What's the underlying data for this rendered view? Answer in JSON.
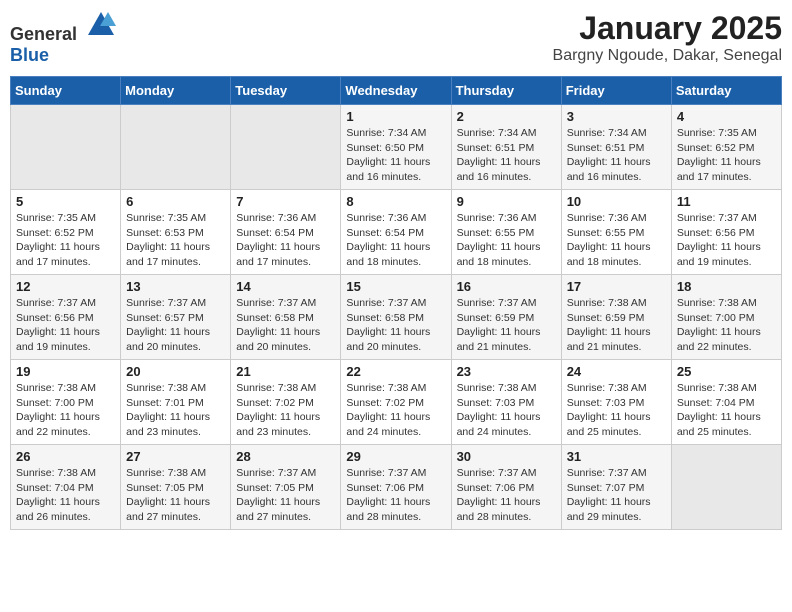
{
  "header": {
    "logo_general": "General",
    "logo_blue": "Blue",
    "month": "January 2025",
    "location": "Bargny Ngoude, Dakar, Senegal"
  },
  "weekdays": [
    "Sunday",
    "Monday",
    "Tuesday",
    "Wednesday",
    "Thursday",
    "Friday",
    "Saturday"
  ],
  "weeks": [
    [
      {
        "day": "",
        "info": ""
      },
      {
        "day": "",
        "info": ""
      },
      {
        "day": "",
        "info": ""
      },
      {
        "day": "1",
        "info": "Sunrise: 7:34 AM\nSunset: 6:50 PM\nDaylight: 11 hours\nand 16 minutes."
      },
      {
        "day": "2",
        "info": "Sunrise: 7:34 AM\nSunset: 6:51 PM\nDaylight: 11 hours\nand 16 minutes."
      },
      {
        "day": "3",
        "info": "Sunrise: 7:34 AM\nSunset: 6:51 PM\nDaylight: 11 hours\nand 16 minutes."
      },
      {
        "day": "4",
        "info": "Sunrise: 7:35 AM\nSunset: 6:52 PM\nDaylight: 11 hours\nand 17 minutes."
      }
    ],
    [
      {
        "day": "5",
        "info": "Sunrise: 7:35 AM\nSunset: 6:52 PM\nDaylight: 11 hours\nand 17 minutes."
      },
      {
        "day": "6",
        "info": "Sunrise: 7:35 AM\nSunset: 6:53 PM\nDaylight: 11 hours\nand 17 minutes."
      },
      {
        "day": "7",
        "info": "Sunrise: 7:36 AM\nSunset: 6:54 PM\nDaylight: 11 hours\nand 17 minutes."
      },
      {
        "day": "8",
        "info": "Sunrise: 7:36 AM\nSunset: 6:54 PM\nDaylight: 11 hours\nand 18 minutes."
      },
      {
        "day": "9",
        "info": "Sunrise: 7:36 AM\nSunset: 6:55 PM\nDaylight: 11 hours\nand 18 minutes."
      },
      {
        "day": "10",
        "info": "Sunrise: 7:36 AM\nSunset: 6:55 PM\nDaylight: 11 hours\nand 18 minutes."
      },
      {
        "day": "11",
        "info": "Sunrise: 7:37 AM\nSunset: 6:56 PM\nDaylight: 11 hours\nand 19 minutes."
      }
    ],
    [
      {
        "day": "12",
        "info": "Sunrise: 7:37 AM\nSunset: 6:56 PM\nDaylight: 11 hours\nand 19 minutes."
      },
      {
        "day": "13",
        "info": "Sunrise: 7:37 AM\nSunset: 6:57 PM\nDaylight: 11 hours\nand 20 minutes."
      },
      {
        "day": "14",
        "info": "Sunrise: 7:37 AM\nSunset: 6:58 PM\nDaylight: 11 hours\nand 20 minutes."
      },
      {
        "day": "15",
        "info": "Sunrise: 7:37 AM\nSunset: 6:58 PM\nDaylight: 11 hours\nand 20 minutes."
      },
      {
        "day": "16",
        "info": "Sunrise: 7:37 AM\nSunset: 6:59 PM\nDaylight: 11 hours\nand 21 minutes."
      },
      {
        "day": "17",
        "info": "Sunrise: 7:38 AM\nSunset: 6:59 PM\nDaylight: 11 hours\nand 21 minutes."
      },
      {
        "day": "18",
        "info": "Sunrise: 7:38 AM\nSunset: 7:00 PM\nDaylight: 11 hours\nand 22 minutes."
      }
    ],
    [
      {
        "day": "19",
        "info": "Sunrise: 7:38 AM\nSunset: 7:00 PM\nDaylight: 11 hours\nand 22 minutes."
      },
      {
        "day": "20",
        "info": "Sunrise: 7:38 AM\nSunset: 7:01 PM\nDaylight: 11 hours\nand 23 minutes."
      },
      {
        "day": "21",
        "info": "Sunrise: 7:38 AM\nSunset: 7:02 PM\nDaylight: 11 hours\nand 23 minutes."
      },
      {
        "day": "22",
        "info": "Sunrise: 7:38 AM\nSunset: 7:02 PM\nDaylight: 11 hours\nand 24 minutes."
      },
      {
        "day": "23",
        "info": "Sunrise: 7:38 AM\nSunset: 7:03 PM\nDaylight: 11 hours\nand 24 minutes."
      },
      {
        "day": "24",
        "info": "Sunrise: 7:38 AM\nSunset: 7:03 PM\nDaylight: 11 hours\nand 25 minutes."
      },
      {
        "day": "25",
        "info": "Sunrise: 7:38 AM\nSunset: 7:04 PM\nDaylight: 11 hours\nand 25 minutes."
      }
    ],
    [
      {
        "day": "26",
        "info": "Sunrise: 7:38 AM\nSunset: 7:04 PM\nDaylight: 11 hours\nand 26 minutes."
      },
      {
        "day": "27",
        "info": "Sunrise: 7:38 AM\nSunset: 7:05 PM\nDaylight: 11 hours\nand 27 minutes."
      },
      {
        "day": "28",
        "info": "Sunrise: 7:37 AM\nSunset: 7:05 PM\nDaylight: 11 hours\nand 27 minutes."
      },
      {
        "day": "29",
        "info": "Sunrise: 7:37 AM\nSunset: 7:06 PM\nDaylight: 11 hours\nand 28 minutes."
      },
      {
        "day": "30",
        "info": "Sunrise: 7:37 AM\nSunset: 7:06 PM\nDaylight: 11 hours\nand 28 minutes."
      },
      {
        "day": "31",
        "info": "Sunrise: 7:37 AM\nSunset: 7:07 PM\nDaylight: 11 hours\nand 29 minutes."
      },
      {
        "day": "",
        "info": ""
      }
    ]
  ]
}
